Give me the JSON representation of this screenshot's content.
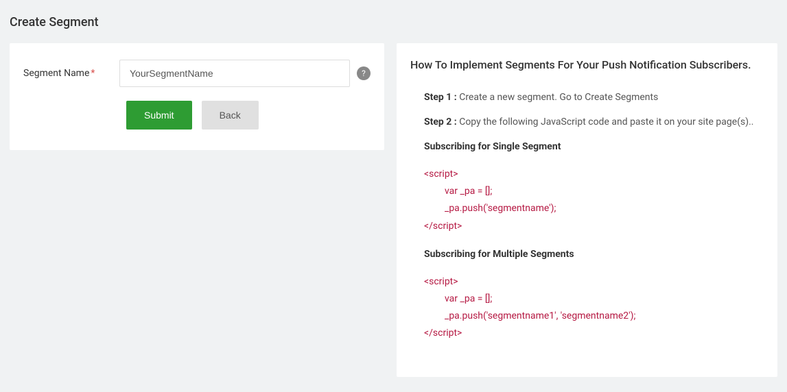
{
  "page": {
    "title": "Create Segment"
  },
  "form": {
    "label": "Segment Name",
    "required_marker": "*",
    "segment_name_value": "YourSegmentName",
    "help_icon_text": "?",
    "submit_label": "Submit",
    "back_label": "Back"
  },
  "help": {
    "title": "How To Implement Segments For Your Push Notification Subscribers.",
    "step1_label": "Step 1 :",
    "step1_text": " Create a new segment. Go to Create Segments",
    "step2_label": "Step 2 :",
    "step2_text": " Copy the following JavaScript code and paste it on your site page(s)..",
    "single_header": "Subscribing for Single Segment",
    "multiple_header": "Subscribing for Multiple Segments",
    "code_single": {
      "open": "<script>",
      "line1": "var _pa = [];",
      "line2": "_pa.push('segmentname');",
      "close": "</script>"
    },
    "code_multiple": {
      "open": "<script>",
      "line1": "var _pa = [];",
      "line2": "_pa.push('segmentname1', 'segmentname2');",
      "close": "</script>"
    }
  }
}
